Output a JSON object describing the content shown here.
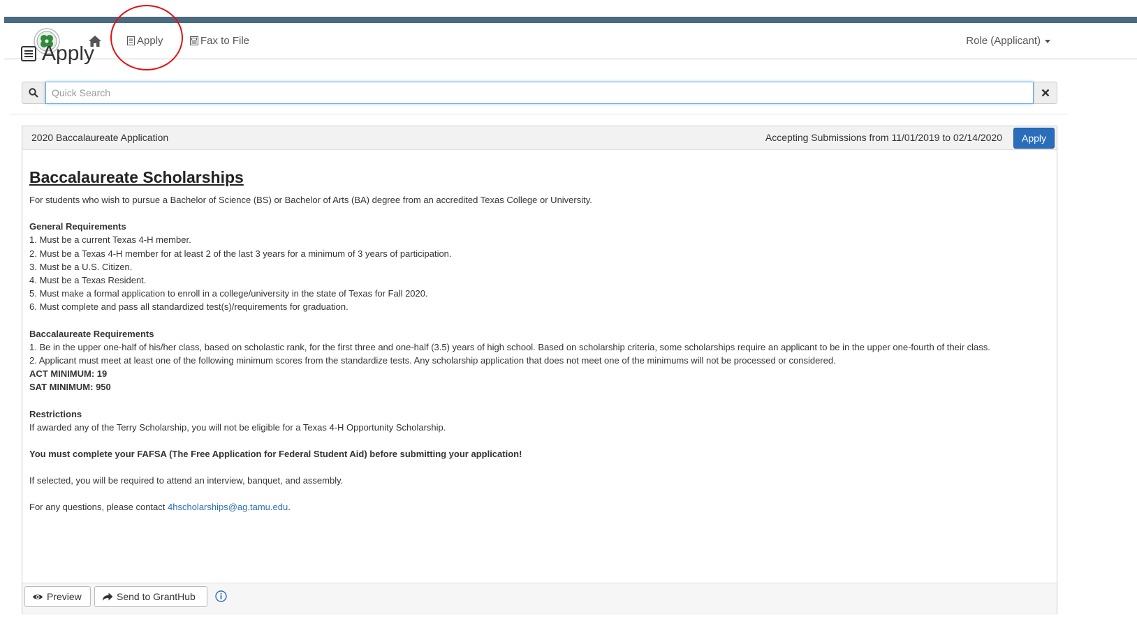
{
  "navbar": {
    "apply_label": "Apply",
    "fax_label": "Fax to File",
    "role_label": "Role (Applicant)"
  },
  "page": {
    "title": "Apply"
  },
  "search": {
    "placeholder": "Quick Search"
  },
  "panel": {
    "title": "2020 Baccalaureate Application",
    "dates": "Accepting Submissions from 11/01/2019 to 02/14/2020",
    "apply_button": "Apply",
    "heading": "Baccalaureate Scholarships",
    "intro": "For students who wish to pursue a Bachelor of Science (BS) or Bachelor of Arts (BA) degree from an accredited Texas College or University.",
    "general_heading": "General Requirements",
    "general_items": [
      "1. Must be a current Texas 4-H member.",
      "2. Must be a Texas 4-H member for at least 2 of the last 3 years for a minimum of 3 years of participation.",
      "3. Must be a U.S. Citizen.",
      "4. Must be a Texas Resident.",
      "5. Must make a formal application to enroll in a college/university in the state of Texas for Fall 2020.",
      "6. Must complete and pass all standardized test(s)/requirements for graduation."
    ],
    "bacc_heading": "Baccalaureate Requirements",
    "bacc_items": [
      "1. Be in the upper one-half of his/her class, based on scholastic rank, for the first three and one-half (3.5) years of high school. Based on scholarship criteria, some scholarships require an applicant to be in the upper one-fourth of their class.",
      "2. Applicant must meet at least one of the following minimum scores from the standardize tests. Any scholarship application that does not meet one of the minimums will not be processed or considered."
    ],
    "act_min": "ACT MINIMUM: 19",
    "sat_min": "SAT MINIMUM: 950",
    "restrictions_heading": "Restrictions",
    "restrictions_text": "If awarded any of the Terry Scholarship, you will not be eligible for a Texas 4-H Opportunity Scholarship.",
    "fafsa_notice": "You must complete your FAFSA (The Free Application for Federal Student Aid) before submitting your application!",
    "selected_text": "If selected, you will be required to attend an interview, banquet, and assembly.",
    "contact_prefix": "For any questions, please contact ",
    "contact_email": "4hscholarships@ag.tamu.edu",
    "contact_suffix": "."
  },
  "footer": {
    "preview_label": "Preview",
    "send_label": "Send to GrantHub"
  },
  "colors": {
    "top_strip": "#4a6a80",
    "primary": "#2a6ebb",
    "annotation_circle": "#e01010"
  },
  "icons": [
    "clover-logo",
    "home-icon",
    "document-icon",
    "fax-icon",
    "search-icon",
    "close-icon",
    "eye-icon",
    "share-icon",
    "info-icon"
  ]
}
